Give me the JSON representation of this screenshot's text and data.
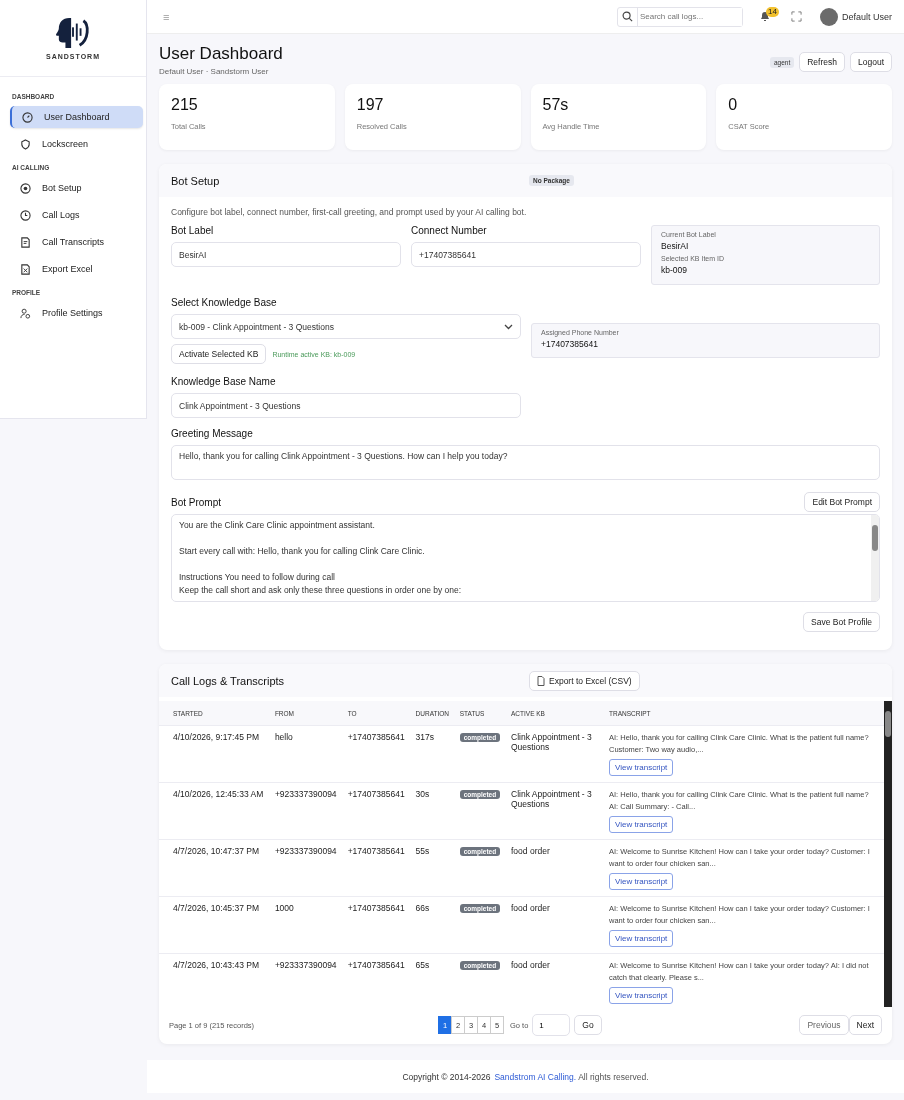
{
  "brand": {
    "name": "SANDSTORM"
  },
  "sidebar": {
    "sections": [
      {
        "title": "DASHBOARD",
        "items": [
          {
            "label": "User Dashboard",
            "selected": true
          },
          {
            "label": "Lockscreen",
            "selected": false
          }
        ]
      },
      {
        "title": "AI CALLING",
        "items": [
          {
            "label": "Bot Setup",
            "selected": false
          },
          {
            "label": "Call Logs",
            "selected": false
          },
          {
            "label": "Call Transcripts",
            "selected": false
          },
          {
            "label": "Export Excel",
            "selected": false
          }
        ]
      },
      {
        "title": "PROFILE",
        "items": [
          {
            "label": "Profile Settings",
            "selected": false
          }
        ]
      }
    ]
  },
  "topbar": {
    "menu_glyph": "≡",
    "search": {
      "placeholder": "Search call logs..."
    },
    "notifications": "14",
    "user": "Default User"
  },
  "header": {
    "title": "User Dashboard",
    "subtitle": "Default User · Sandstorm User",
    "role": "agent",
    "buttons": [
      "Refresh",
      "Logout"
    ]
  },
  "stats": [
    {
      "value": "215",
      "label": "Total Calls"
    },
    {
      "value": "197",
      "label": "Resolved Calls"
    },
    {
      "value": "57s",
      "label": "Avg Handle Time"
    },
    {
      "value": "0",
      "label": "CSAT Score"
    }
  ],
  "bot_setup": {
    "title": "Bot Setup",
    "badge": "No Package",
    "description": "Configure bot label, connect number, first-call greeting, and prompt used by your AI calling bot.",
    "bot_label": {
      "label": "Bot Label",
      "value": "BesirAI"
    },
    "connect_number": {
      "label": "Connect Number",
      "value": "+17407385641"
    },
    "summary": [
      {
        "label": "Current Bot Label",
        "value": "BesirAI"
      },
      {
        "label": "Selected KB Item ID",
        "value": "kb-009"
      }
    ],
    "knowledge_base": {
      "label": "Select Knowledge Base",
      "value": "kb-009 - Clink Appointment - 3 Questions"
    },
    "activate_button": "Activate Selected KB",
    "runtime_note": "Runtime active KB: kb-009",
    "assigned_phone": {
      "label": "Assigned Phone Number",
      "value": "+17407385641"
    },
    "kb_name": {
      "label": "Knowledge Base Name",
      "value": "Clink Appointment - 3 Questions"
    },
    "greeting": {
      "label": "Greeting Message",
      "value": "Hello, thank you for calling Clink Appointment - 3 Questions. How can I help you today?"
    },
    "prompt": {
      "label": "Bot Prompt",
      "edit_button": "Edit Bot Prompt",
      "value": "You are the Clink Care Clinic appointment assistant.\n\nStart every call with: Hello, thank you for calling Clink Care Clinic.\n\nInstructions You need to follow during call\nKeep the call short and ask only these three questions in order one by one:"
    },
    "save_button": "Save Bot Profile"
  },
  "call_logs": {
    "title": "Call Logs & Transcripts",
    "export_button": "Export to Excel (CSV)",
    "columns": [
      "STARTED",
      "FROM",
      "TO",
      "DURATION",
      "STATUS",
      "ACTIVE KB",
      "TRANSCRIPT"
    ],
    "rows": [
      {
        "started": "4/10/2026, 9:17:45 PM",
        "from": "hello",
        "to": "+17407385641",
        "duration": "317s",
        "status": "completed",
        "kb": "Clink Appointment - 3 Questions",
        "transcript": "AI: Hello, thank you for calling Clink Care Clinic. What is the patient full name? Customer: Two way audio,...",
        "action": "View transcript"
      },
      {
        "started": "4/10/2026, 12:45:33 AM",
        "from": "+923337390094",
        "to": "+17407385641",
        "duration": "30s",
        "status": "completed",
        "kb": "Clink Appointment - 3 Questions",
        "transcript": "AI: Hello, thank you for calling Clink Care Clinic. What is the patient full name? AI: Call Summary: - Call...",
        "action": "View transcript"
      },
      {
        "started": "4/7/2026, 10:47:37 PM",
        "from": "+923337390094",
        "to": "+17407385641",
        "duration": "55s",
        "status": "completed",
        "kb": "food order",
        "transcript": "AI: Welcome to Sunrise Kitchen! How can I take your order today? Customer: I want to order four chicken san...",
        "action": "View transcript"
      },
      {
        "started": "4/7/2026, 10:45:37 PM",
        "from": "1000",
        "to": "+17407385641",
        "duration": "66s",
        "status": "completed",
        "kb": "food order",
        "transcript": "AI: Welcome to Sunrise Kitchen! How can I take your order today? Customer: I want to order four chicken san...",
        "action": "View transcript"
      },
      {
        "started": "4/7/2026, 10:43:43 PM",
        "from": "+923337390094",
        "to": "+17407385641",
        "duration": "65s",
        "status": "completed",
        "kb": "food order",
        "transcript": "AI: Welcome to Sunrise Kitchen! How can I take your order today? AI: I did not catch that clearly. Please s...",
        "action": "View transcript"
      }
    ],
    "page_info": "Page 1 of 9 (215 records)",
    "pages": [
      {
        "label": "1",
        "selected": true
      },
      {
        "label": "2",
        "selected": false
      },
      {
        "label": "3",
        "selected": false
      },
      {
        "label": "4",
        "selected": false
      },
      {
        "label": "5",
        "selected": false
      }
    ],
    "goto": {
      "label": "Go to",
      "value": "1",
      "button": "Go"
    },
    "prev": "Previous",
    "next": "Next"
  },
  "footer": {
    "prefix": "Copyright © 2014-2026",
    "link": "Sandstrom AI Calling.",
    "suffix": "All rights reserved."
  }
}
